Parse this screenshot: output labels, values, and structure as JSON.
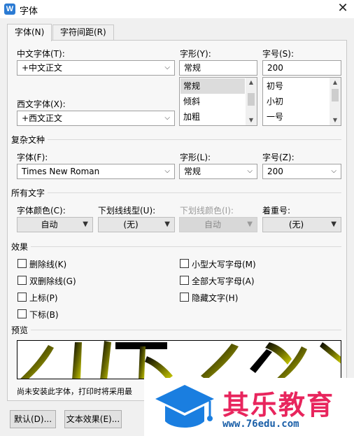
{
  "window": {
    "title": "字体",
    "app_icon_glyph": "W"
  },
  "tabs": [
    {
      "label": "字体(N)"
    },
    {
      "label": "字符间距(R)"
    }
  ],
  "font_tab": {
    "chinese_font": {
      "label": "中文字体(T):",
      "value": "+中文正文"
    },
    "style": {
      "label": "字形(Y):",
      "value": "常规",
      "options": [
        "常规",
        "倾斜",
        "加粗"
      ]
    },
    "size": {
      "label": "字号(S):",
      "value": "200",
      "options": [
        "初号",
        "小初",
        "一号"
      ]
    },
    "western_font": {
      "label": "西文字体(X):",
      "value": "+西文正文"
    },
    "complex": {
      "heading": "复杂文种",
      "font_label": "字体(F):",
      "font_value": "Times New Roman",
      "style_label": "字形(L):",
      "style_value": "常规",
      "size_label": "字号(Z):",
      "size_value": "200"
    },
    "all_text": {
      "heading": "所有文字",
      "color_label": "字体颜色(C):",
      "color_value": "自动",
      "underline_label": "下划线线型(U):",
      "underline_value": "(无)",
      "underline_color_label": "下划线颜色(I):",
      "underline_color_value": "自动",
      "emphasis_label": "着重号:",
      "emphasis_value": "(无)"
    },
    "effects": {
      "heading": "效果",
      "strikethrough": "删除线(K)",
      "double_strikethrough": "双删除线(G)",
      "superscript": "上标(P)",
      "subscript": "下标(B)",
      "small_caps": "小型大写字母(M)",
      "all_caps": "全部大写字母(A)",
      "hidden": "隐藏文字(H)"
    },
    "preview": {
      "heading": "预览",
      "note": "尚未安装此字体，打印时将采用最"
    }
  },
  "buttons": {
    "default": "默认(D)...",
    "text_effects": "文本效果(E)..."
  },
  "watermark": {
    "name": "其乐教育",
    "url": "www.76edu.com"
  },
  "colors": {
    "accent": "#2b7bd3",
    "preview_glyph": "#9a9a00",
    "watermark_text": "#e8255d"
  }
}
